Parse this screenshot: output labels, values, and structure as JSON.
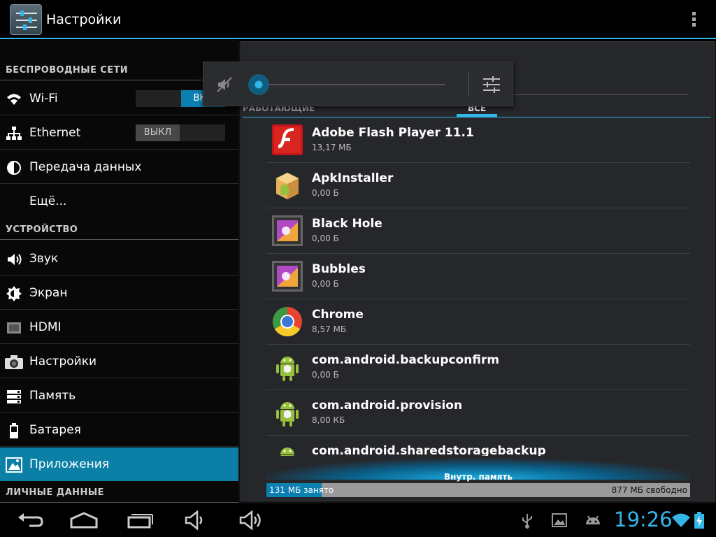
{
  "action_bar": {
    "title": "Настройки"
  },
  "sections": {
    "wireless": "БЕСПРОВОДНЫЕ СЕТИ",
    "device": "УСТРОЙСТВО",
    "personal": "ЛИЧНЫЕ ДАННЫЕ"
  },
  "settings": {
    "wifi": {
      "label": "Wi-Fi",
      "toggle": "ВКЛ",
      "state": "on"
    },
    "ethernet": {
      "label": "Ethernet",
      "toggle": "ВЫКЛ",
      "state": "off"
    },
    "data_usage": {
      "label": "Передача данных"
    },
    "more": {
      "label": "Ещё..."
    },
    "sound": {
      "label": "Звук"
    },
    "display": {
      "label": "Экран"
    },
    "hdmi": {
      "label": "HDMI"
    },
    "camera_settings": {
      "label": "Настройки"
    },
    "storage": {
      "label": "Память"
    },
    "battery": {
      "label": "Батарея"
    },
    "apps": {
      "label": "Приложения",
      "selected": true
    }
  },
  "apps_pane": {
    "tabs": {
      "running": "РАБОТАЮЩИЕ",
      "all": "ВСЕ"
    },
    "apps": [
      {
        "name": "Adobe Flash Player 11.1",
        "size": "13,17 МБ",
        "icon": "flash-icon"
      },
      {
        "name": "ApkInstaller",
        "size": "0,00 Б",
        "icon": "package-icon"
      },
      {
        "name": "Black Hole",
        "size": "0,00 Б",
        "icon": "wallpaper-icon"
      },
      {
        "name": "Bubbles",
        "size": "0,00 Б",
        "icon": "wallpaper-icon"
      },
      {
        "name": "Chrome",
        "size": "8,57 МБ",
        "icon": "chrome-icon"
      },
      {
        "name": "com.android.backupconfirm",
        "size": "0,00 Б",
        "icon": "android-icon"
      },
      {
        "name": "com.android.provision",
        "size": "8,00 КБ",
        "icon": "android-icon"
      },
      {
        "name": "com.android.sharedstoragebackup",
        "size": "",
        "icon": "android-icon"
      }
    ],
    "storage": {
      "title": "Внутр. память",
      "used": "131 МБ занято",
      "free": "877 МБ свободно",
      "used_fraction": 0.13
    }
  },
  "volume_popup": {
    "level": 0,
    "muted": true
  },
  "system_bar": {
    "clock": "19:26"
  },
  "colors": {
    "accent": "#33b5e5",
    "selected": "#0b7fa6"
  }
}
